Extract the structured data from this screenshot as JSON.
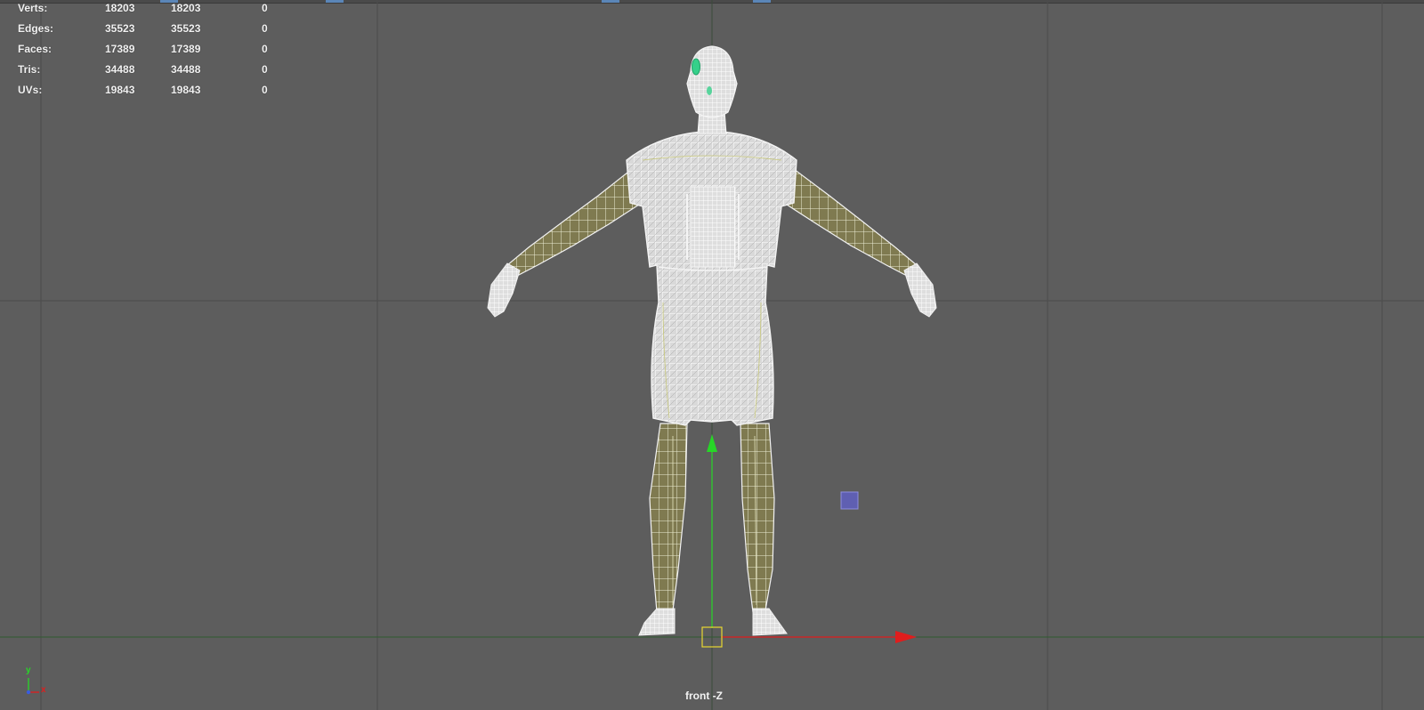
{
  "viewport": {
    "camera_label": "front -Z",
    "background_color": "#5d5d5d",
    "grid_color": "#4c4c4c",
    "axis_x_color": "#e01d1d",
    "axis_y_color": "#27d627"
  },
  "hud": {
    "rows": [
      {
        "label": "Verts:",
        "v1": "18203",
        "v2": "18203",
        "v3": "0"
      },
      {
        "label": "Edges:",
        "v1": "35523",
        "v2": "35523",
        "v3": "0"
      },
      {
        "label": "Faces:",
        "v1": "17389",
        "v2": "17389",
        "v3": "0"
      },
      {
        "label": "Tris:",
        "v1": "34488",
        "v2": "34488",
        "v3": "0"
      },
      {
        "label": "UVs:",
        "v1": "19843",
        "v2": "19843",
        "v3": "0"
      }
    ]
  },
  "gizmo": {
    "y_label": "y",
    "x_label": "x",
    "icons": [
      "axis-gizmo-icon",
      "move-manipulator-icon",
      "selected-object-icon"
    ]
  }
}
